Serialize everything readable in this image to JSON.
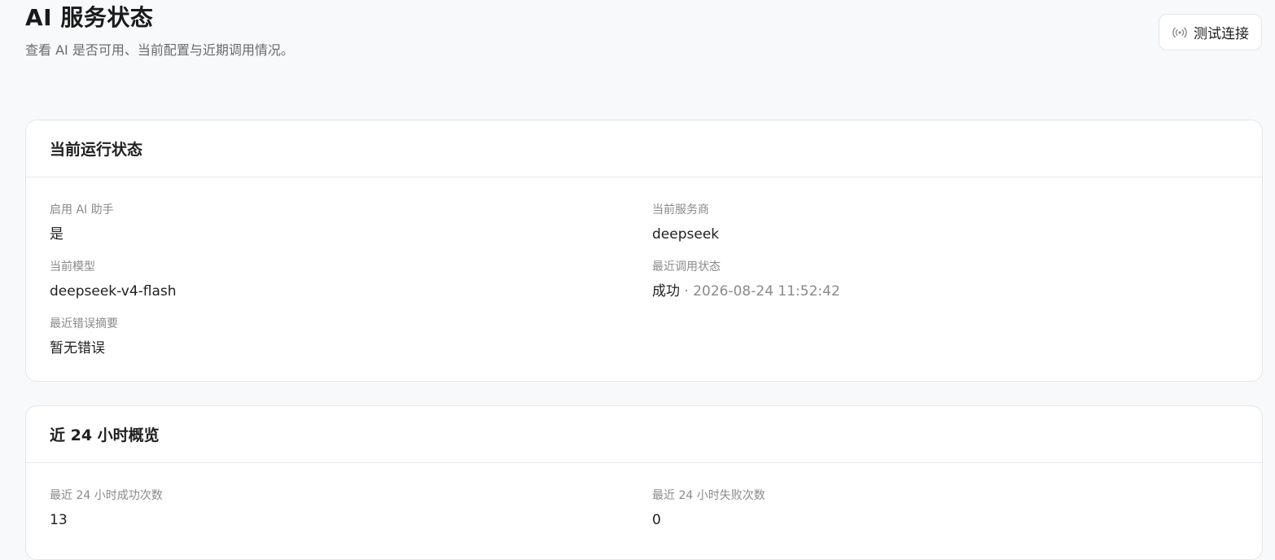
{
  "header": {
    "title": "AI 服务状态",
    "subtitle": "查看 AI 是否可用、当前配置与近期调用情况。",
    "test_button_label": "测试连接",
    "test_button_icon": "broadcast-icon"
  },
  "status_card": {
    "title": "当前运行状态",
    "fields": {
      "ai_enabled": {
        "label": "启用 AI 助手",
        "value": "是"
      },
      "provider": {
        "label": "当前服务商",
        "value": "deepseek"
      },
      "model": {
        "label": "当前模型",
        "value": "deepseek-v4-flash"
      },
      "last_call": {
        "label": "最近调用状态",
        "status": "成功",
        "separator": " · ",
        "timestamp": "2026-08-24 11:52:42"
      },
      "last_error": {
        "label": "最近错误摘要",
        "value": "暂无错误"
      }
    }
  },
  "overview_card": {
    "title": "近 24 小时概览",
    "fields": {
      "success_count": {
        "label": "最近 24 小时成功次数",
        "value": "13"
      },
      "failure_count": {
        "label": "最近 24 小时失败次数",
        "value": "0"
      }
    }
  },
  "colors": {
    "background": "#f8f9fb",
    "card": "#ffffff",
    "border": "#e3e5e9",
    "text": "#1f1f1f",
    "muted": "#8a8a8a"
  }
}
